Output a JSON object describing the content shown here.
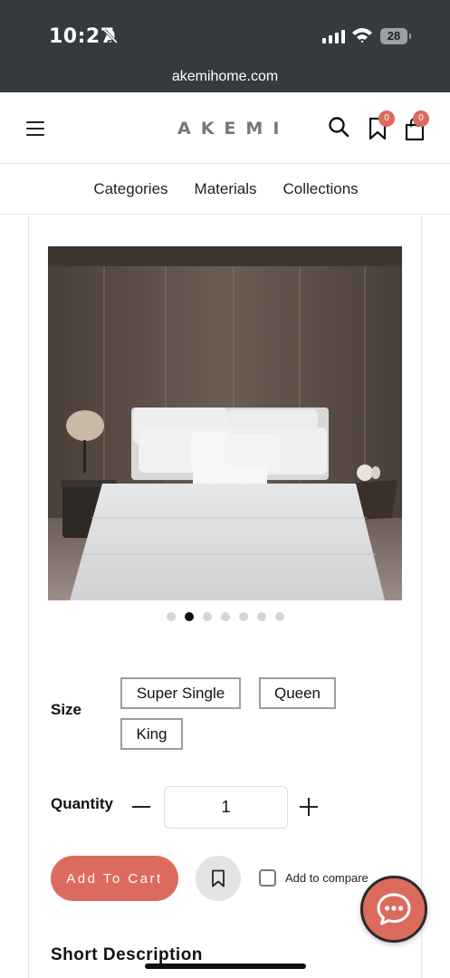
{
  "status_bar": {
    "time": "10:27",
    "battery": "28",
    "url": "akemihome.com"
  },
  "header": {
    "logo": "AKEMI",
    "wishlist_count": "0",
    "cart_count": "0"
  },
  "nav": {
    "items": [
      "Categories",
      "Materials",
      "Collections"
    ]
  },
  "gallery": {
    "total_images": 7,
    "active_index": 1
  },
  "size": {
    "label": "Size",
    "options": [
      "Super Single",
      "Queen",
      "King"
    ]
  },
  "quantity": {
    "label": "Quantity",
    "value": "1"
  },
  "actions": {
    "add_to_cart": "Add To Cart",
    "compare_label": "Add to compare"
  },
  "sections": {
    "short_description": "Short Description"
  },
  "colors": {
    "accent": "#dc6b5e",
    "status_bar": "#363a3c"
  }
}
